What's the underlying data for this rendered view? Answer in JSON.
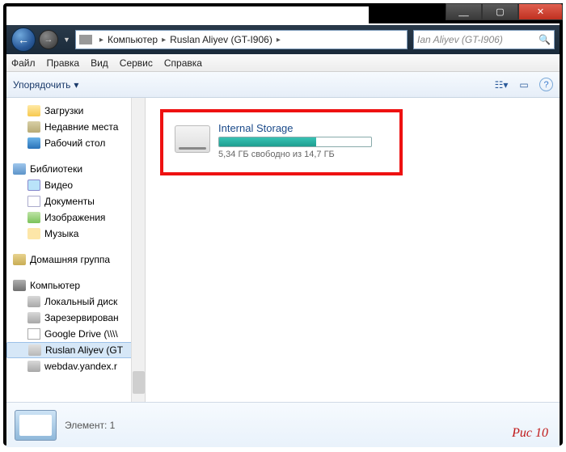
{
  "titlebar": {
    "min": "__",
    "max": "▢",
    "close": "✕"
  },
  "nav": {
    "back": "←",
    "fwd": "→",
    "drop": "▼",
    "crumb_sep": "▸",
    "crumbs": [
      "Компьютер",
      "Ruslan Aliyev (GT-I906)"
    ],
    "search_hint": "Ian Aliyev (GT-I906)",
    "search_icon": "🔍"
  },
  "menu": {
    "file": "Файл",
    "edit": "Правка",
    "view": "Вид",
    "tools": "Сервис",
    "help": "Справка"
  },
  "toolbar": {
    "organize": "Упорядочить",
    "organize_arrow": "▾",
    "views_icon": "☷",
    "views_arrow": "▾",
    "details_icon": "▭",
    "help_icon": "?"
  },
  "tree": {
    "downloads": "Загрузки",
    "recent": "Недавние места",
    "desktop": "Рабочий стол",
    "libraries": "Библиотеки",
    "video": "Видео",
    "documents": "Документы",
    "pictures": "Изображения",
    "music": "Музыка",
    "homegroup": "Домашняя группа",
    "computer": "Компьютер",
    "localdisk": "Локальный диск",
    "reserved": "Зарезервирован",
    "gdrive": "Google Drive (\\\\\\\\",
    "device": "Ruslan Aliyev (GT",
    "webdav": "webdav.yandex.r"
  },
  "content": {
    "storage_name": "Internal Storage",
    "free_text": "5,34 ГБ свободно из 14,7 ГБ",
    "fill_percent": 64
  },
  "details": {
    "label": "Элемент: 1"
  },
  "caption": "Рис 10"
}
